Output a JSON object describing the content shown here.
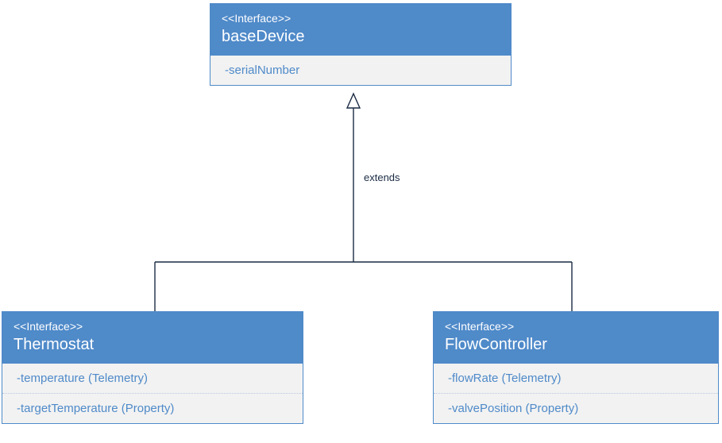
{
  "diagram": {
    "relationship_label": "extends",
    "boxes": {
      "base": {
        "stereotype": "<<Interface>>",
        "name": "baseDevice",
        "attrs": [
          "-serialNumber"
        ]
      },
      "thermostat": {
        "stereotype": "<<Interface>>",
        "name": "Thermostat",
        "attrs": [
          "-temperature (Telemetry)",
          "-targetTemperature (Property)"
        ]
      },
      "flow": {
        "stereotype": "<<Interface>>",
        "name": "FlowController",
        "attrs": [
          "-flowRate (Telemetry)",
          "-valvePosition (Property)"
        ]
      }
    }
  }
}
